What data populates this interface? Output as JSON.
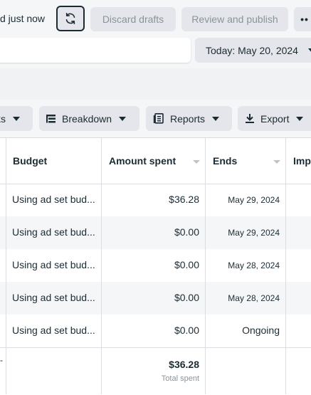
{
  "topbar": {
    "saved_text": "d just now",
    "refresh_icon": "refresh-icon",
    "discard_label": "Discard drafts",
    "review_label": "Review and publish",
    "more_label": "••"
  },
  "search": {
    "placeholder": ""
  },
  "date_range": {
    "label": "Today: May 20, 2024",
    "icon": "chevron-down-icon"
  },
  "toolbar": {
    "metrics_label": "ks",
    "breakdown_label": "Breakdown",
    "reports_label": "Reports",
    "export_label": "Export"
  },
  "table": {
    "headers": {
      "budget": "Budget",
      "amount_spent": "Amount spent",
      "ends": "Ends",
      "impressions": "Imp"
    },
    "rows": [
      {
        "budget": "Using ad set bud...",
        "amount": "$36.28",
        "ends": "May 29, 2024"
      },
      {
        "budget": "Using ad set bud...",
        "amount": "$0.00",
        "ends": "May 29, 2024"
      },
      {
        "budget": "Using ad set bud...",
        "amount": "$0.00",
        "ends": "May 28, 2024"
      },
      {
        "budget": "Using ad set bud...",
        "amount": "$0.00",
        "ends": "May 28, 2024"
      },
      {
        "budget": "Using ad set bud...",
        "amount": "$0.00",
        "ends": "Ongoing"
      }
    ],
    "summary": {
      "dash": "-",
      "amount": "$36.28",
      "label": "Total spent"
    }
  },
  "colors": {
    "button_gray": "#e4e6eb",
    "disabled_text": "#8a939b",
    "border": "#dadde1",
    "alt_row": "#f5f6f7"
  }
}
